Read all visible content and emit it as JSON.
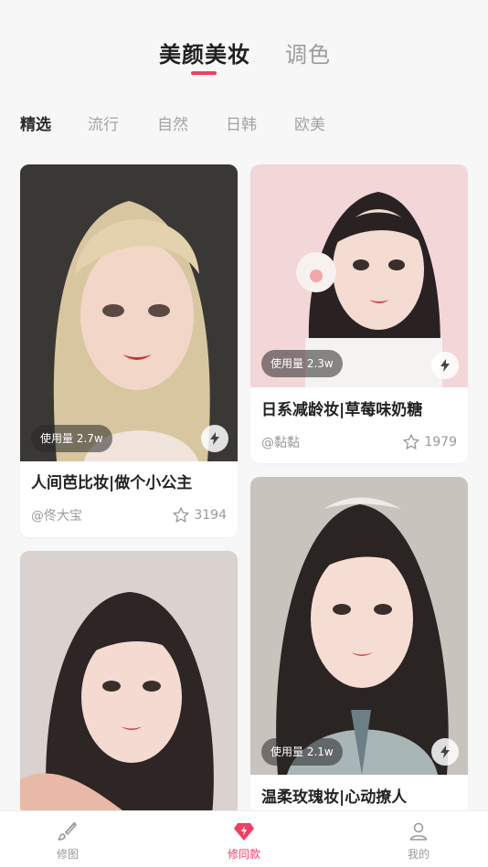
{
  "top_tabs": [
    {
      "label": "美颜美妆",
      "active": true
    },
    {
      "label": "调色",
      "active": false
    }
  ],
  "accent_color": "#ef3f63",
  "category_tabs": [
    {
      "label": "精选",
      "active": true
    },
    {
      "label": "流行",
      "active": false
    },
    {
      "label": "自然",
      "active": false
    },
    {
      "label": "日韩",
      "active": false
    },
    {
      "label": "欧美",
      "active": false
    }
  ],
  "cards": [
    {
      "usage": "使用量 2.7w",
      "title": "人间芭比妆|做个小公主",
      "author": "@佟大宝",
      "likes": "3194",
      "icon": "lightning-icon"
    },
    {
      "usage": "使用量 2.3w",
      "title": "日系减龄妆|草莓味奶糖",
      "author": "@黏黏",
      "likes": "1979",
      "icon": "lightning-icon"
    },
    {
      "usage": "",
      "title": "",
      "author": "",
      "likes": "",
      "icon": ""
    },
    {
      "usage": "使用量 2.1w",
      "title": "温柔玫瑰妆|心动撩人",
      "author": "",
      "likes": "",
      "icon": "lightning-icon"
    }
  ],
  "bottom_nav": [
    {
      "label": "修图",
      "icon": "brush-icon",
      "active": false
    },
    {
      "label": "修同款",
      "icon": "diamond-icon",
      "active": true
    },
    {
      "label": "我的",
      "icon": "user-icon",
      "active": false
    }
  ]
}
